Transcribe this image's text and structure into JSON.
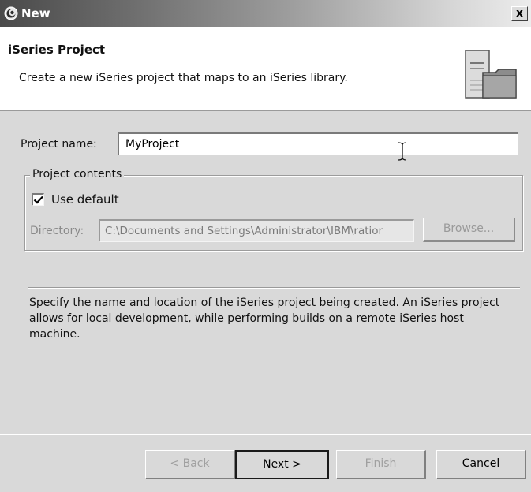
{
  "window": {
    "title": "New",
    "close_glyph": "x"
  },
  "banner": {
    "title": "iSeries Project",
    "description": "Create a new iSeries project that maps to an iSeries library.",
    "icon": "iseries-project-wizard-icon"
  },
  "form": {
    "project_name_label": "Project name:",
    "project_name_value": "MyProject",
    "group_label": "Project contents",
    "use_default_label": "Use default",
    "use_default_checked": true,
    "directory_label": "Directory:",
    "directory_value": "C:\\Documents and Settings\\Administrator\\IBM\\ratior",
    "browse_label": "Browse..."
  },
  "help_text": "Specify the name and location of the iSeries project being created. An iSeries project allows for local development, while performing builds on a remote iSeries host machine.",
  "buttons": {
    "back": "< Back",
    "next": "Next >",
    "finish": "Finish",
    "cancel": "Cancel"
  },
  "colors": {
    "titlebar_dark": "#4a4a4a",
    "dialog_background": "#d9d9d9",
    "banner_background": "#ffffff",
    "disabled_text": "#a0a0a0"
  }
}
